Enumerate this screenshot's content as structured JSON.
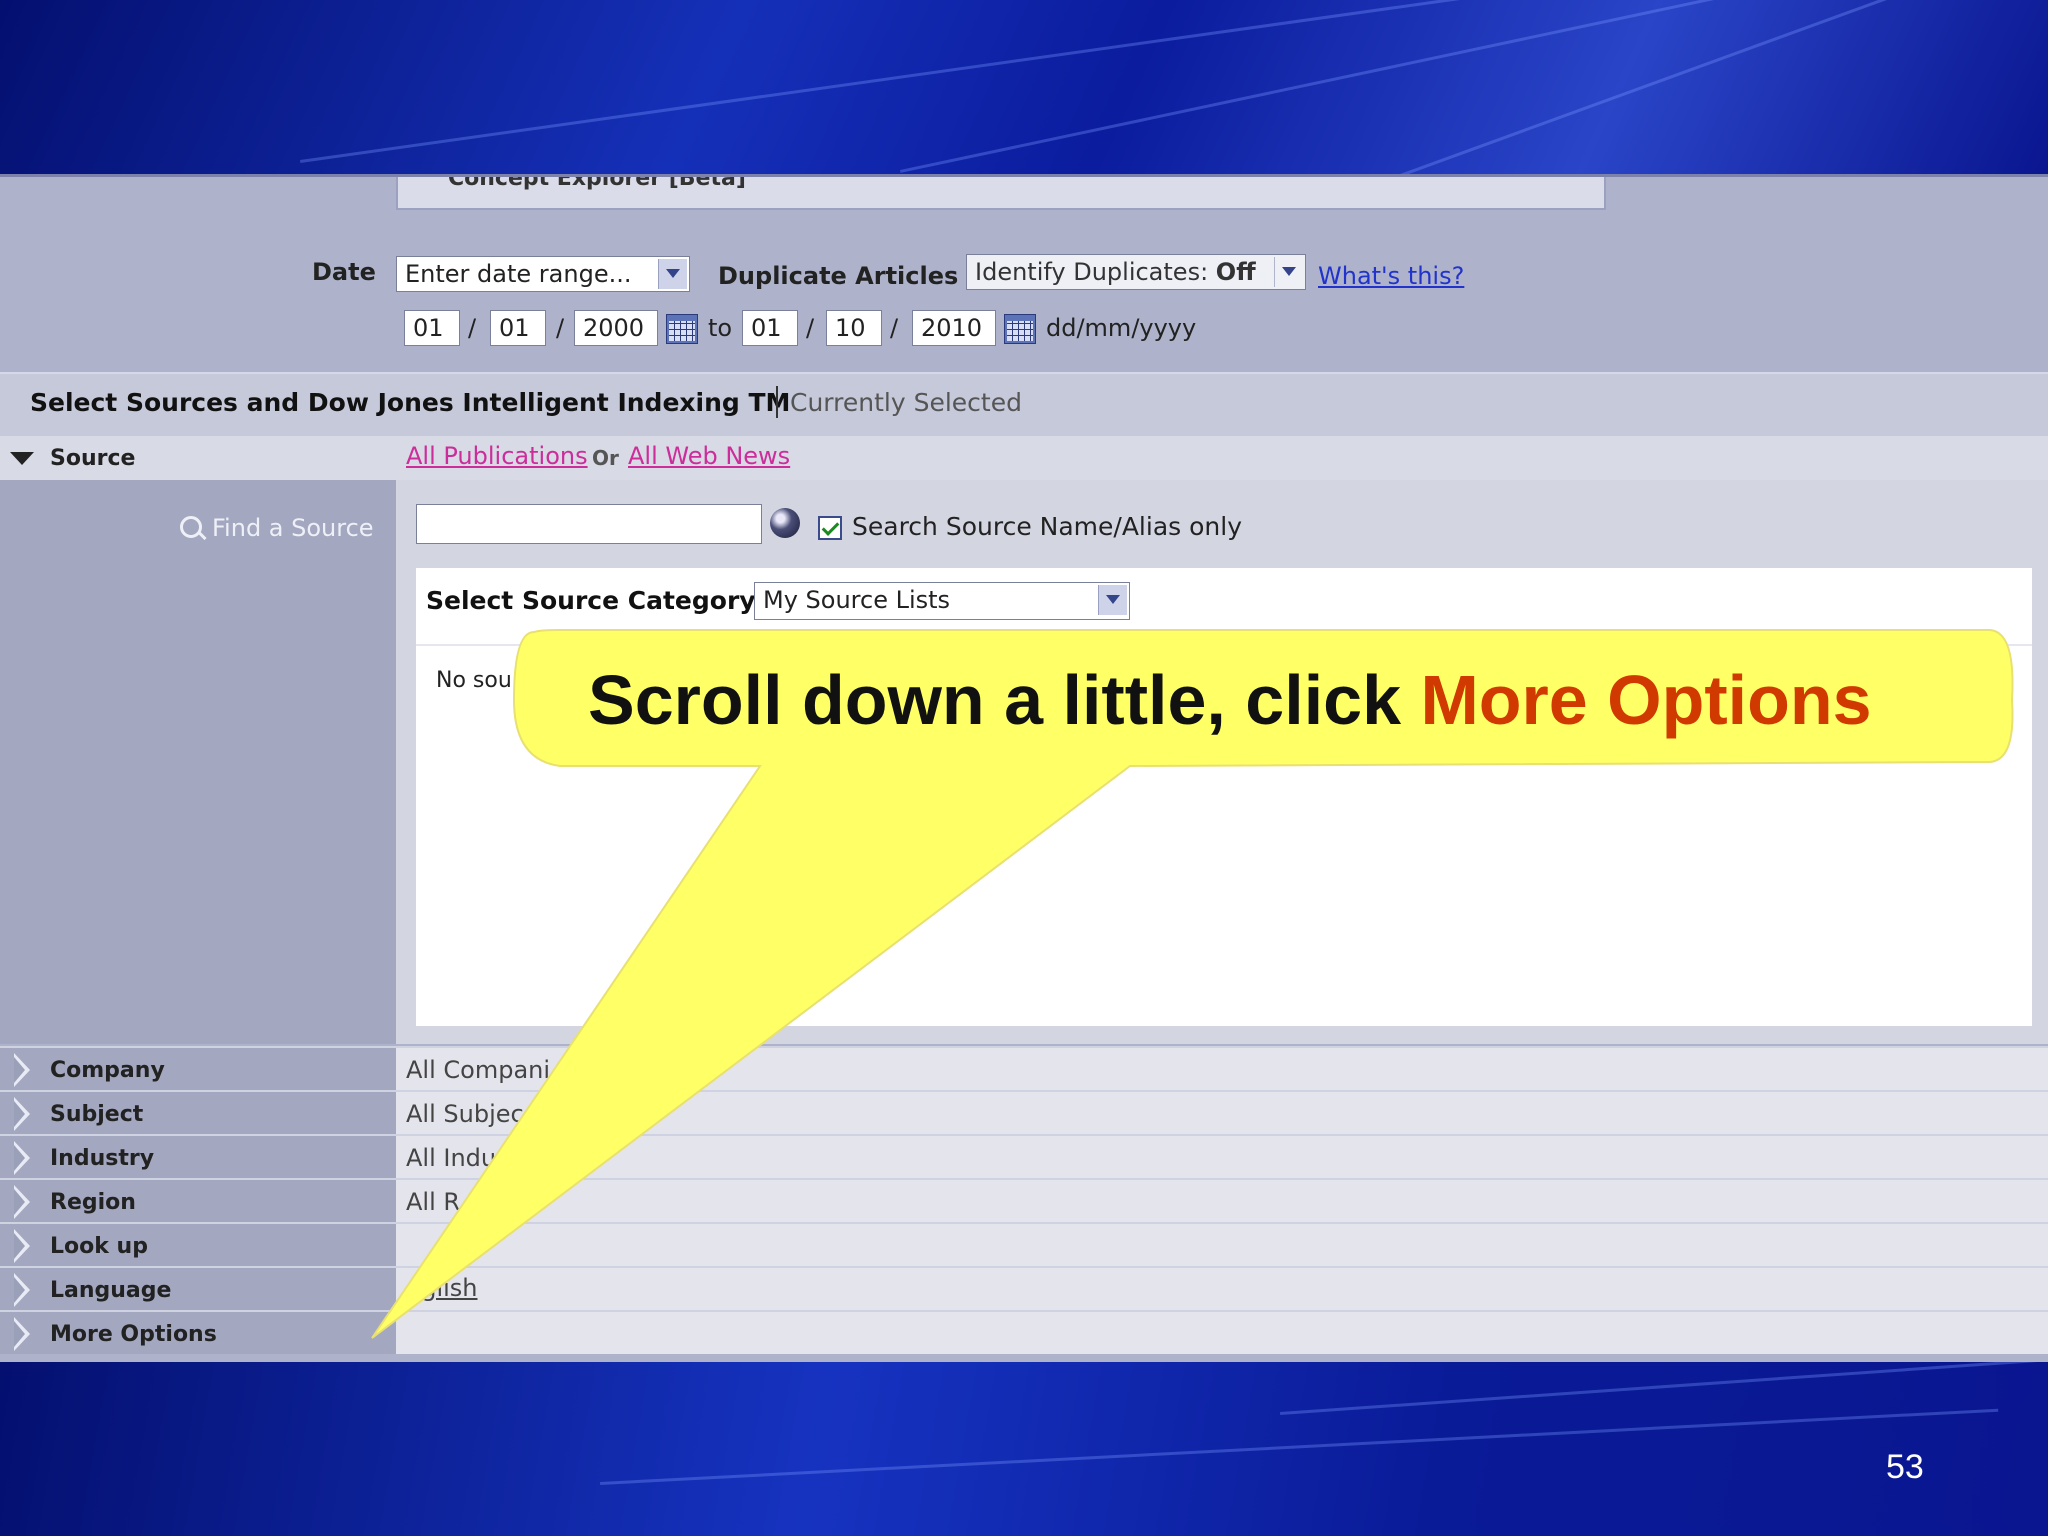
{
  "slide": {
    "number": "53"
  },
  "top_fragment": {
    "text": "Concept Explorer [Beta]"
  },
  "date": {
    "label": "Date",
    "range_select": "Enter date range...",
    "from": {
      "day": "01",
      "month": "01",
      "year": "2000"
    },
    "to_label": "to",
    "to": {
      "day": "01",
      "month": "10",
      "year": "2010"
    },
    "format_hint": "dd/mm/yyyy"
  },
  "duplicates": {
    "label": "Duplicate Articles",
    "select_prefix": "Identify Duplicates: ",
    "select_value": "Off",
    "help_link": "What's this?"
  },
  "sources_header": {
    "title": "Select Sources and Dow Jones Intelligent Indexing TM",
    "current": "Currently Selected"
  },
  "source": {
    "label": "Source",
    "all_publications": "All Publications",
    "or_text": "Or",
    "all_web_news": "All Web News",
    "find_label": "Find a Source",
    "search_value": "",
    "checkbox_label": "Search Source Name/Alias only",
    "category_label": "Select Source Category",
    "category_value": "My Source Lists",
    "empty_text": "No sou"
  },
  "categories": [
    {
      "label": "Company",
      "value": "All Compani"
    },
    {
      "label": "Subject",
      "value": "All Subjec"
    },
    {
      "label": "Industry",
      "value": "All Indu"
    },
    {
      "label": "Region",
      "value": "All R"
    },
    {
      "label": "Look up",
      "value": ""
    },
    {
      "label": "Language",
      "value": "nglish"
    },
    {
      "label": "More Options",
      "value": ""
    }
  ],
  "callout": {
    "text": "Scroll down a little, click ",
    "highlight": "More Options"
  },
  "colors": {
    "slide_background": "#0a1a9a",
    "callout_fill": "#ffff66",
    "callout_highlight": "#d03a00",
    "link_blue": "#2233cc",
    "link_pink": "#cc2d9a"
  }
}
